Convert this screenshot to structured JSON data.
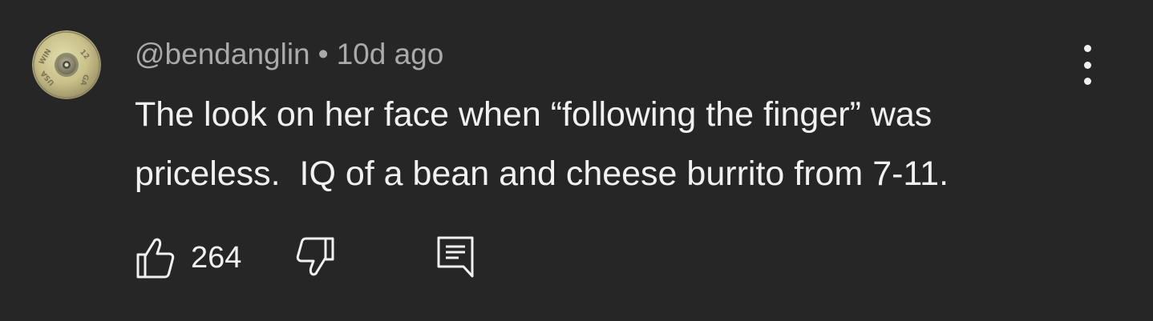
{
  "comment": {
    "author": "@bendanglin",
    "separator": "•",
    "timestamp": "10d ago",
    "text": "The look on her face when “following the finger” was priceless.  IQ of a bean and cheese burrito from 7-11.",
    "like_count": "264"
  },
  "icons": {
    "avatar": "avatar-shell-casing-icon",
    "more": "more-vertical-icon",
    "like": "thumbs-up-icon",
    "dislike": "thumbs-down-icon",
    "reply": "reply-comment-icon"
  },
  "colors": {
    "background": "#262626",
    "primary_text": "#f1f1f1",
    "secondary_text": "#aaaaaa"
  }
}
